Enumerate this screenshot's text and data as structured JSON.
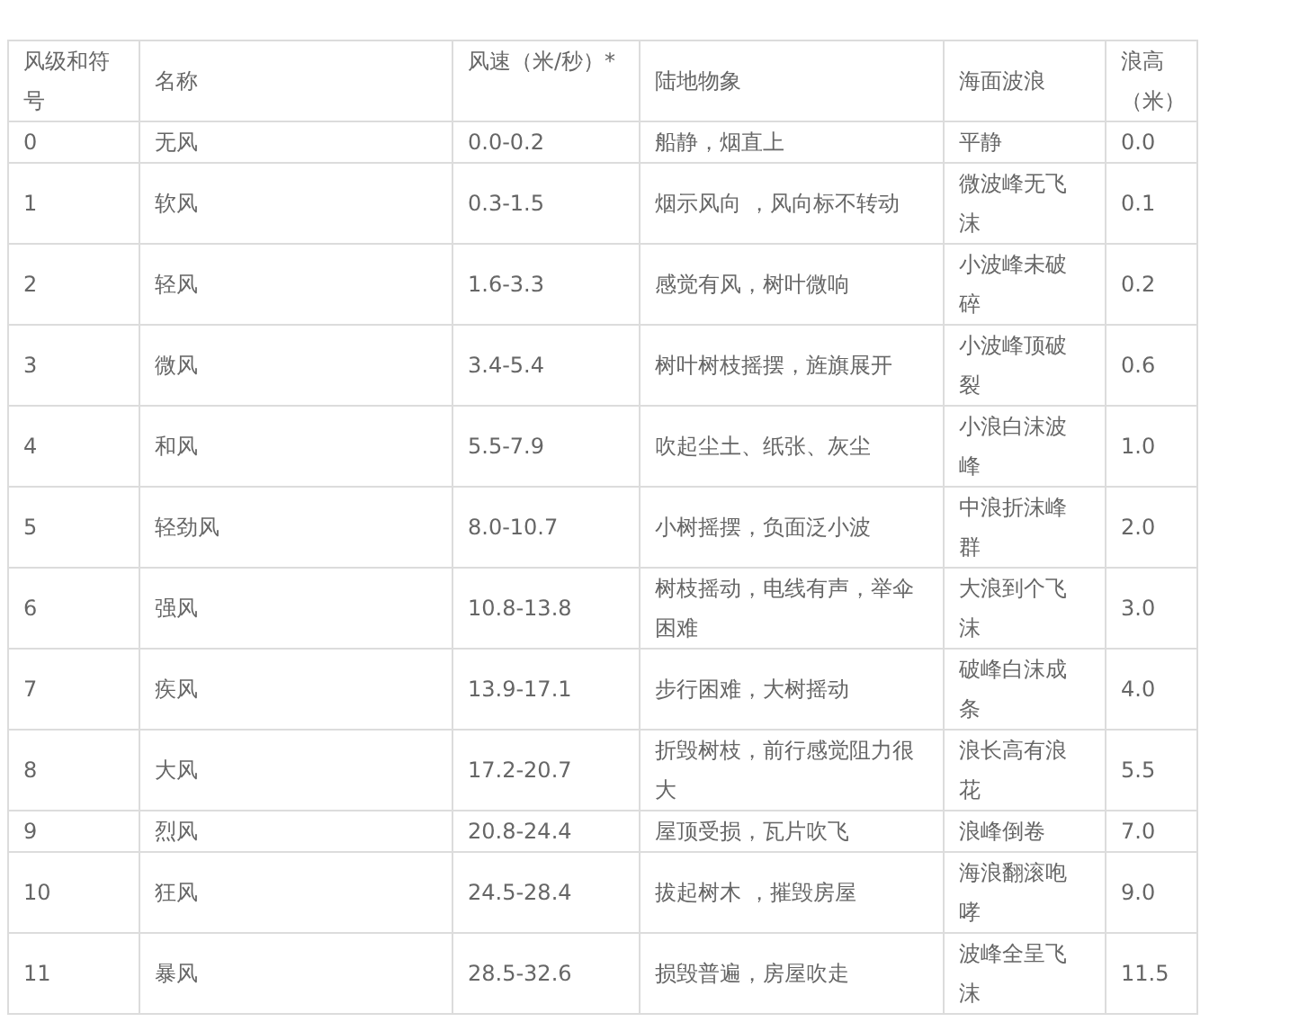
{
  "table": {
    "columns": [
      "风级和符号",
      "名称",
      "风速（米/秒）*",
      "陆地物象",
      "海面波浪",
      "浪高（米）"
    ],
    "rows": [
      [
        "0",
        "无风",
        "0.0-0.2",
        "船静，烟直上",
        "平静",
        "0.0"
      ],
      [
        "1",
        "软风",
        "0.3-1.5",
        "烟示风向 ，风向标不转动",
        "微波峰无飞沫",
        "0.1"
      ],
      [
        "2",
        "轻风",
        "1.6-3.3",
        "感觉有风，树叶微响",
        "小波峰未破碎",
        "0.2"
      ],
      [
        "3",
        "微风",
        "3.4-5.4",
        "树叶树枝摇摆，旌旗展开",
        "小波峰顶破裂",
        "0.6"
      ],
      [
        "4",
        "和风",
        "5.5-7.9",
        "吹起尘土、纸张、灰尘",
        "小浪白沫波峰",
        "1.0"
      ],
      [
        "5",
        "轻劲风",
        "8.0-10.7",
        "小树摇摆，负面泛小波",
        "中浪折沫峰群",
        "2.0"
      ],
      [
        "6",
        "强风",
        "10.8-13.8",
        "树枝摇动，电线有声，举伞困难",
        "大浪到个飞沫",
        "3.0"
      ],
      [
        "7",
        "疾风",
        "13.9-17.1",
        "步行困难，大树摇动",
        "破峰白沫成条",
        "4.0"
      ],
      [
        "8",
        "大风",
        "17.2-20.7",
        "折毁树枝，前行感觉阻力很大",
        "浪长高有浪花",
        "5.5"
      ],
      [
        "9",
        "烈风",
        "20.8-24.4",
        "屋顶受损，瓦片吹飞",
        "浪峰倒卷",
        "7.0"
      ],
      [
        "10",
        "狂风",
        "24.5-28.4",
        "拔起树木 ，摧毁房屋",
        "海浪翻滚咆哮",
        "9.0"
      ],
      [
        "11",
        "暴风",
        "28.5-32.6",
        "损毁普遍，房屋吹走",
        "波峰全呈飞沫",
        "11.5"
      ]
    ]
  }
}
